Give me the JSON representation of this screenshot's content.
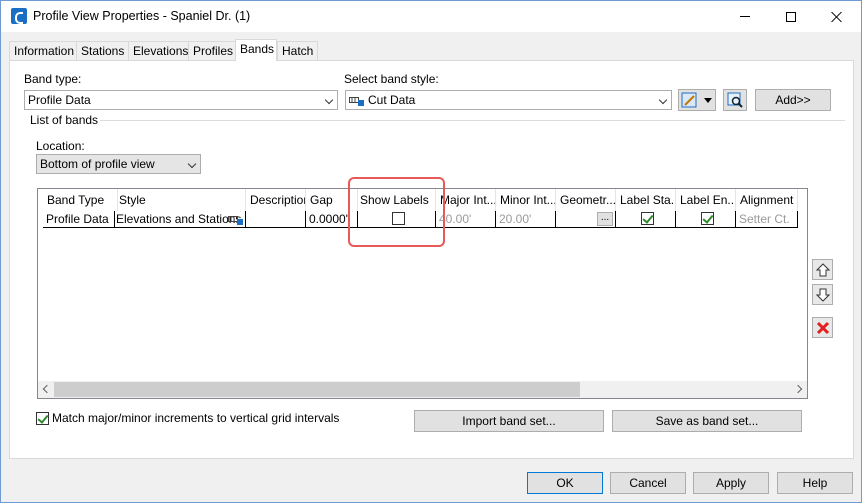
{
  "window": {
    "title": "Profile View Properties - Spaniel Dr. (1)"
  },
  "tabs": [
    "Information",
    "Stations",
    "Elevations",
    "Profiles",
    "Bands",
    "Hatch"
  ],
  "active_tab": "Bands",
  "band_type": {
    "label": "Band type:",
    "value": "Profile Data"
  },
  "band_style": {
    "label": "Select band style:",
    "value": "Cut Data"
  },
  "add_button": "Add>>",
  "list_of_bands": "List of bands",
  "location": {
    "label": "Location:",
    "value": "Bottom of profile view"
  },
  "grid": {
    "columns": [
      "Band Type",
      "Style",
      "Description",
      "Gap",
      "Show Labels",
      "Major Int...",
      "Minor Int...",
      "Geometr...",
      "Label Sta...",
      "Label En...",
      "Alignment"
    ],
    "rows": [
      {
        "band_type": "Profile Data",
        "style": "Elevations and Stations",
        "description": "",
        "gap": "0.0000\"",
        "show_labels": false,
        "major_int": "40.00'",
        "minor_int": "20.00'",
        "geometry": "...",
        "label_start": true,
        "label_end": true,
        "alignment": "Setter Ct."
      }
    ]
  },
  "match_checkbox": {
    "label": "Match major/minor increments to vertical grid intervals",
    "checked": true
  },
  "import_button": "Import band set...",
  "save_button": "Save as band set...",
  "footer": {
    "ok": "OK",
    "cancel": "Cancel",
    "apply": "Apply",
    "help": "Help"
  },
  "colors": {
    "highlight": "#e85a5a",
    "titlebar_icon": "#1a6fc4",
    "delete_icon": "#e02020"
  }
}
